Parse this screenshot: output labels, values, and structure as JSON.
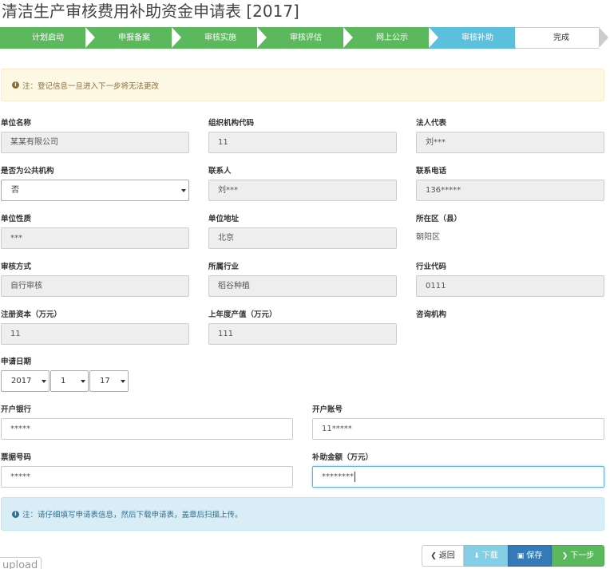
{
  "title": "清洁生产审核费用补助资金申请表 [2017]",
  "steps": [
    {
      "label": "计划启动",
      "state": "done"
    },
    {
      "label": "申报备案",
      "state": "done"
    },
    {
      "label": "审核实施",
      "state": "done"
    },
    {
      "label": "审核评估",
      "state": "done"
    },
    {
      "label": "网上公示",
      "state": "done"
    },
    {
      "label": "审核补助",
      "state": "active"
    },
    {
      "label": "完成",
      "state": "todo"
    }
  ],
  "colors": {
    "done": "#5cb85c",
    "active": "#5bc0de",
    "warn_bg": "#fcf8e3",
    "info_bg": "#d9edf7",
    "primary": "#337ab7"
  },
  "notice_top": "注：登记信息一旦进入下一步将无法更改",
  "notice_bottom": "注：请仔细填写申请表信息，然后下载申请表，盖章后扫描上传。",
  "fields": {
    "unit_name": {
      "label": "单位名称",
      "value": "某某有限公司"
    },
    "org_code": {
      "label": "组织机构代码",
      "value": "11"
    },
    "legal_rep": {
      "label": "法人代表",
      "value": "刘***"
    },
    "public_org": {
      "label": "是否为公共机构",
      "value": "否"
    },
    "contact": {
      "label": "联系人",
      "value": "刘***"
    },
    "phone": {
      "label": "联系电话",
      "value": "136*****"
    },
    "unit_type": {
      "label": "单位性质",
      "value": "***"
    },
    "address": {
      "label": "单位地址",
      "value": "北京"
    },
    "district": {
      "label": "所在区（县）",
      "value": "朝阳区"
    },
    "audit_method": {
      "label": "审核方式",
      "value": "自行审核"
    },
    "industry": {
      "label": "所属行业",
      "value": "稻谷种植"
    },
    "industry_code": {
      "label": "行业代码",
      "value": "0111"
    },
    "reg_capital": {
      "label": "注册资本（万元）",
      "value": "11"
    },
    "last_output": {
      "label": "上年度产值（万元）",
      "value": "111"
    },
    "consult_org": {
      "label": "咨询机构"
    },
    "apply_date": {
      "label": "申请日期",
      "year": "2017",
      "month": "1",
      "day": "17"
    },
    "bank": {
      "label": "开户银行",
      "value": "*****"
    },
    "account": {
      "label": "开户账号",
      "value": "11*****"
    },
    "invoice_no": {
      "label": "票据号码",
      "value": "*****"
    },
    "subsidy": {
      "label": "补助金额（万元）",
      "value": "********"
    }
  },
  "buttons": {
    "back": "返回",
    "download": "下载",
    "save": "保存",
    "next": "下一步"
  },
  "upload_tag": "upload"
}
